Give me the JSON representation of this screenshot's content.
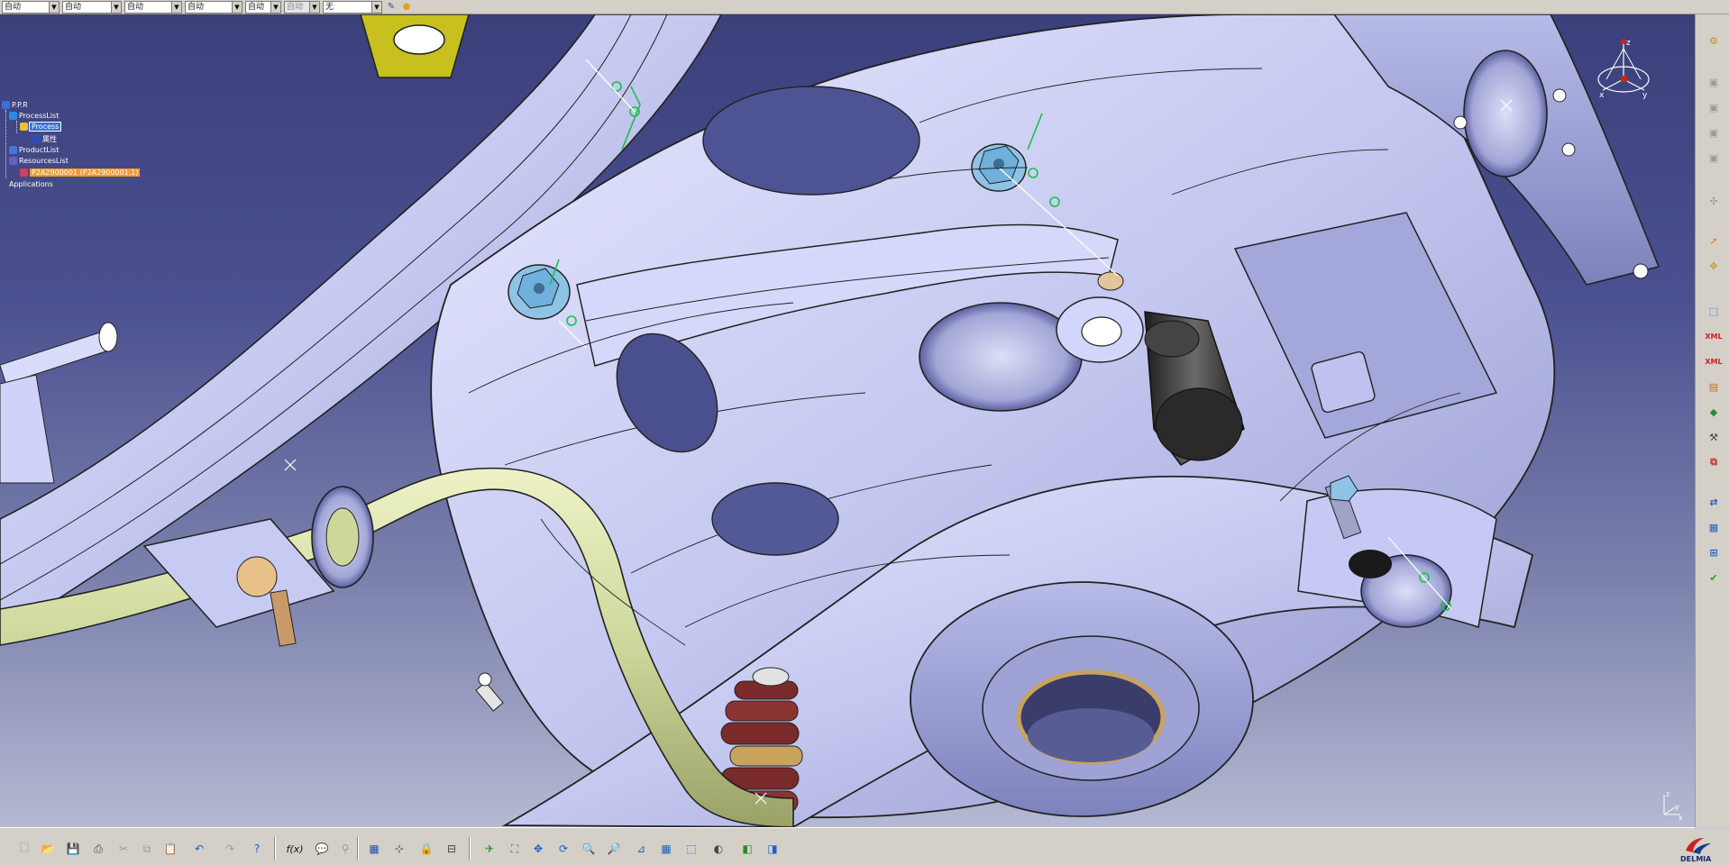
{
  "topbar": {
    "combos": [
      {
        "value": "自动",
        "disabled": false
      },
      {
        "value": "自动",
        "disabled": false
      },
      {
        "value": "自动",
        "disabled": false
      },
      {
        "value": "自动",
        "disabled": false
      },
      {
        "value": "自动",
        "disabled": false
      },
      {
        "value": "自动",
        "disabled": true
      },
      {
        "value": "无",
        "disabled": false
      }
    ]
  },
  "tree": {
    "root": "P.P.R",
    "process_list": "ProcessList",
    "process": "Process",
    "attribute": "属性",
    "product_list": "ProductList",
    "resources_list": "ResourcesList",
    "resource_item": "P2A2900001 (P2A2900001.1)",
    "applications": "Applications"
  },
  "compass": {
    "label_x": "x",
    "label_y": "y",
    "label_z": "z"
  },
  "axis_triad": {
    "x": "x",
    "y": "y",
    "z": "z"
  },
  "brand": {
    "logo_text": "DELMIA"
  },
  "right_toolbar": {
    "xml_label_1": "XML",
    "xml_label_2": "XML"
  },
  "bottom_toolbar": {
    "formula_label": "f(x)"
  },
  "colors": {
    "part": "#c9ccf0",
    "part_shadow": "#8f93c7",
    "stabilizer": "#cdd79a",
    "bushing": "#3c3c3c",
    "bolt": "#8fc3e6",
    "spring": "#7a2a2a",
    "bracket_yellow": "#c8c01e",
    "background_top": "#3b3f7a",
    "background_bottom": "#b5b9d2"
  }
}
